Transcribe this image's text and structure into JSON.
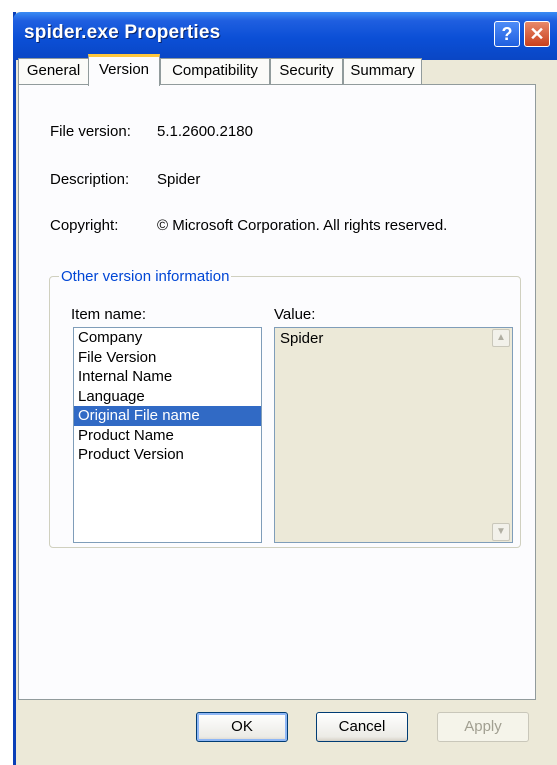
{
  "window": {
    "title": "spider.exe Properties",
    "help_label": "?",
    "close_label": "✕"
  },
  "tabs": [
    {
      "label": "General"
    },
    {
      "label": "Version",
      "active": true
    },
    {
      "label": "Compatibility"
    },
    {
      "label": "Security"
    },
    {
      "label": "Summary"
    }
  ],
  "info": {
    "file_version_label": "File version:",
    "file_version_value": "5.1.2600.2180",
    "description_label": "Description:",
    "description_value": "Spider",
    "copyright_label": "Copyright:",
    "copyright_value": "© Microsoft Corporation. All rights reserved."
  },
  "other": {
    "legend": "Other version information",
    "item_name_label": "Item name:",
    "value_label": "Value:",
    "items": [
      "Company",
      "File Version",
      "Internal Name",
      "Language",
      "Original File name",
      "Product Name",
      "Product Version"
    ],
    "selected_item": "Original File name",
    "value_text": "Spider"
  },
  "buttons": {
    "ok": "OK",
    "cancel": "Cancel",
    "apply": "Apply"
  },
  "colors": {
    "titlebar": "#0b4fd6",
    "selection": "#316ac5",
    "group_legend": "#0046d5",
    "active_tab_highlight": "#ffc73c"
  }
}
